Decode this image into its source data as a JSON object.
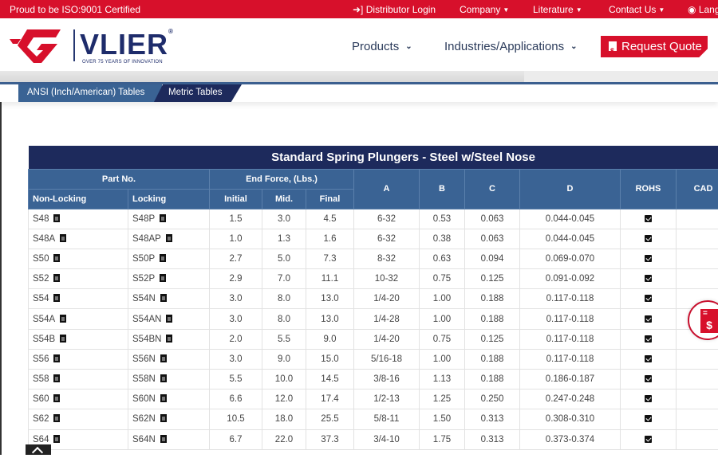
{
  "topbar": {
    "certification": "Proud to be ISO:9001 Certified",
    "links": [
      {
        "label": "Distributor Login",
        "icon": "sign-in-icon"
      },
      {
        "label": "Company",
        "icon": "chevron-down-icon"
      },
      {
        "label": "Literature",
        "icon": "chevron-down-icon"
      },
      {
        "label": "Contact Us",
        "icon": "chevron-down-icon"
      },
      {
        "label": "Lang",
        "icon": "language-icon"
      }
    ]
  },
  "header": {
    "brand": "VLIER",
    "tagline": "OVER 75 YEARS OF INNOVATION",
    "nav": [
      {
        "label": "Products"
      },
      {
        "label": "Industries/Applications"
      }
    ],
    "quote_button": "Request Quote"
  },
  "tabs": [
    {
      "label": "ANSI (Inch/American) Tables",
      "active": false
    },
    {
      "label": "Metric Tables",
      "active": true
    }
  ],
  "table": {
    "title": "Standard Spring Plungers - Steel w/Steel Nose",
    "group_headers": {
      "part_no": "Part No.",
      "end_force": "End Force, (Lbs.)"
    },
    "columns": {
      "non_locking": "Non-Locking",
      "locking": "Locking",
      "initial": "Initial",
      "mid": "Mid.",
      "final": "Final",
      "a": "A",
      "b": "B",
      "c": "C",
      "d": "D",
      "rohs": "ROHS",
      "cad": "CAD"
    },
    "rows": [
      {
        "non_locking": "S48",
        "locking": "S48P",
        "initial": "1.5",
        "mid": "3.0",
        "final": "4.5",
        "a": "6-32",
        "b": "0.53",
        "c": "0.063",
        "d": "0.044-0.045",
        "rohs": true
      },
      {
        "non_locking": "S48A",
        "locking": "S48AP",
        "initial": "1.0",
        "mid": "1.3",
        "final": "1.6",
        "a": "6-32",
        "b": "0.38",
        "c": "0.063",
        "d": "0.044-0.045",
        "rohs": true
      },
      {
        "non_locking": "S50",
        "locking": "S50P",
        "initial": "2.7",
        "mid": "5.0",
        "final": "7.3",
        "a": "8-32",
        "b": "0.63",
        "c": "0.094",
        "d": "0.069-0.070",
        "rohs": true
      },
      {
        "non_locking": "S52",
        "locking": "S52P",
        "initial": "2.9",
        "mid": "7.0",
        "final": "11.1",
        "a": "10-32",
        "b": "0.75",
        "c": "0.125",
        "d": "0.091-0.092",
        "rohs": true
      },
      {
        "non_locking": "S54",
        "locking": "S54N",
        "initial": "3.0",
        "mid": "8.0",
        "final": "13.0",
        "a": "1/4-20",
        "b": "1.00",
        "c": "0.188",
        "d": "0.117-0.118",
        "rohs": true
      },
      {
        "non_locking": "S54A",
        "locking": "S54AN",
        "initial": "3.0",
        "mid": "8.0",
        "final": "13.0",
        "a": "1/4-28",
        "b": "1.00",
        "c": "0.188",
        "d": "0.117-0.118",
        "rohs": true
      },
      {
        "non_locking": "S54B",
        "locking": "S54BN",
        "initial": "2.0",
        "mid": "5.5",
        "final": "9.0",
        "a": "1/4-20",
        "b": "0.75",
        "c": "0.125",
        "d": "0.117-0.118",
        "rohs": true
      },
      {
        "non_locking": "S56",
        "locking": "S56N",
        "initial": "3.0",
        "mid": "9.0",
        "final": "15.0",
        "a": "5/16-18",
        "b": "1.00",
        "c": "0.188",
        "d": "0.117-0.118",
        "rohs": true
      },
      {
        "non_locking": "S58",
        "locking": "S58N",
        "initial": "5.5",
        "mid": "10.0",
        "final": "14.5",
        "a": "3/8-16",
        "b": "1.13",
        "c": "0.188",
        "d": "0.186-0.187",
        "rohs": true
      },
      {
        "non_locking": "S60",
        "locking": "S60N",
        "initial": "6.6",
        "mid": "12.0",
        "final": "17.4",
        "a": "1/2-13",
        "b": "1.25",
        "c": "0.250",
        "d": "0.247-0.248",
        "rohs": true
      },
      {
        "non_locking": "S62",
        "locking": "S62N",
        "initial": "10.5",
        "mid": "18.0",
        "final": "25.5",
        "a": "5/8-11",
        "b": "1.50",
        "c": "0.313",
        "d": "0.308-0.310",
        "rohs": true
      },
      {
        "non_locking": "S64",
        "locking": "S64N",
        "initial": "6.7",
        "mid": "22.0",
        "final": "37.3",
        "a": "3/4-10",
        "b": "1.75",
        "c": "0.313",
        "d": "0.373-0.374",
        "rohs": true
      }
    ]
  },
  "colors": {
    "brand_red": "#d7102b",
    "navy": "#1d2a5c",
    "header_blue": "#3a6394"
  }
}
